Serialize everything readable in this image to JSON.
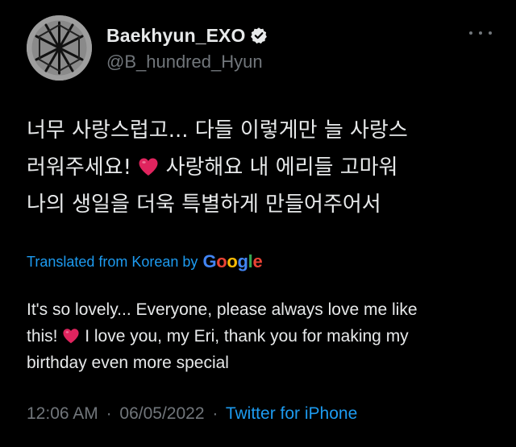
{
  "author": {
    "display_name": "Baekhyun_EXO",
    "handle": "@B_hundred_Hyun",
    "verified": true
  },
  "icons": {
    "avatar": "exo-logo-avatar",
    "verified": "verified-badge-icon",
    "more": "more-options-icon",
    "heart": "red-heart-emoji"
  },
  "tweet": {
    "korean_line1": "너무 사랑스럽고... 다들 이렇게만 늘 사랑스",
    "korean_line2_a": "러워주세요!",
    "korean_line2_b": "사랑해요 내 에리들 고마워",
    "korean_line3": "나의 생일을 더욱 특별하게 만들어주어서",
    "translated_label": "Translated from Korean by",
    "google_letters": [
      "G",
      "o",
      "o",
      "g",
      "l",
      "e"
    ],
    "english_line1": "It's so lovely... Everyone, please always love me like",
    "english_line2_a": "this!",
    "english_line2_b": "I love you, my Eri, thank you for making my",
    "english_line3": "birthday even more special"
  },
  "meta": {
    "time": "12:06 AM",
    "separator": "·",
    "date": "06/05/2022",
    "source": "Twitter for iPhone"
  },
  "colors": {
    "background": "#000000",
    "text": "#e7e9ea",
    "muted": "#71767b",
    "link": "#1d9bf0",
    "heart": "#e0245e"
  }
}
